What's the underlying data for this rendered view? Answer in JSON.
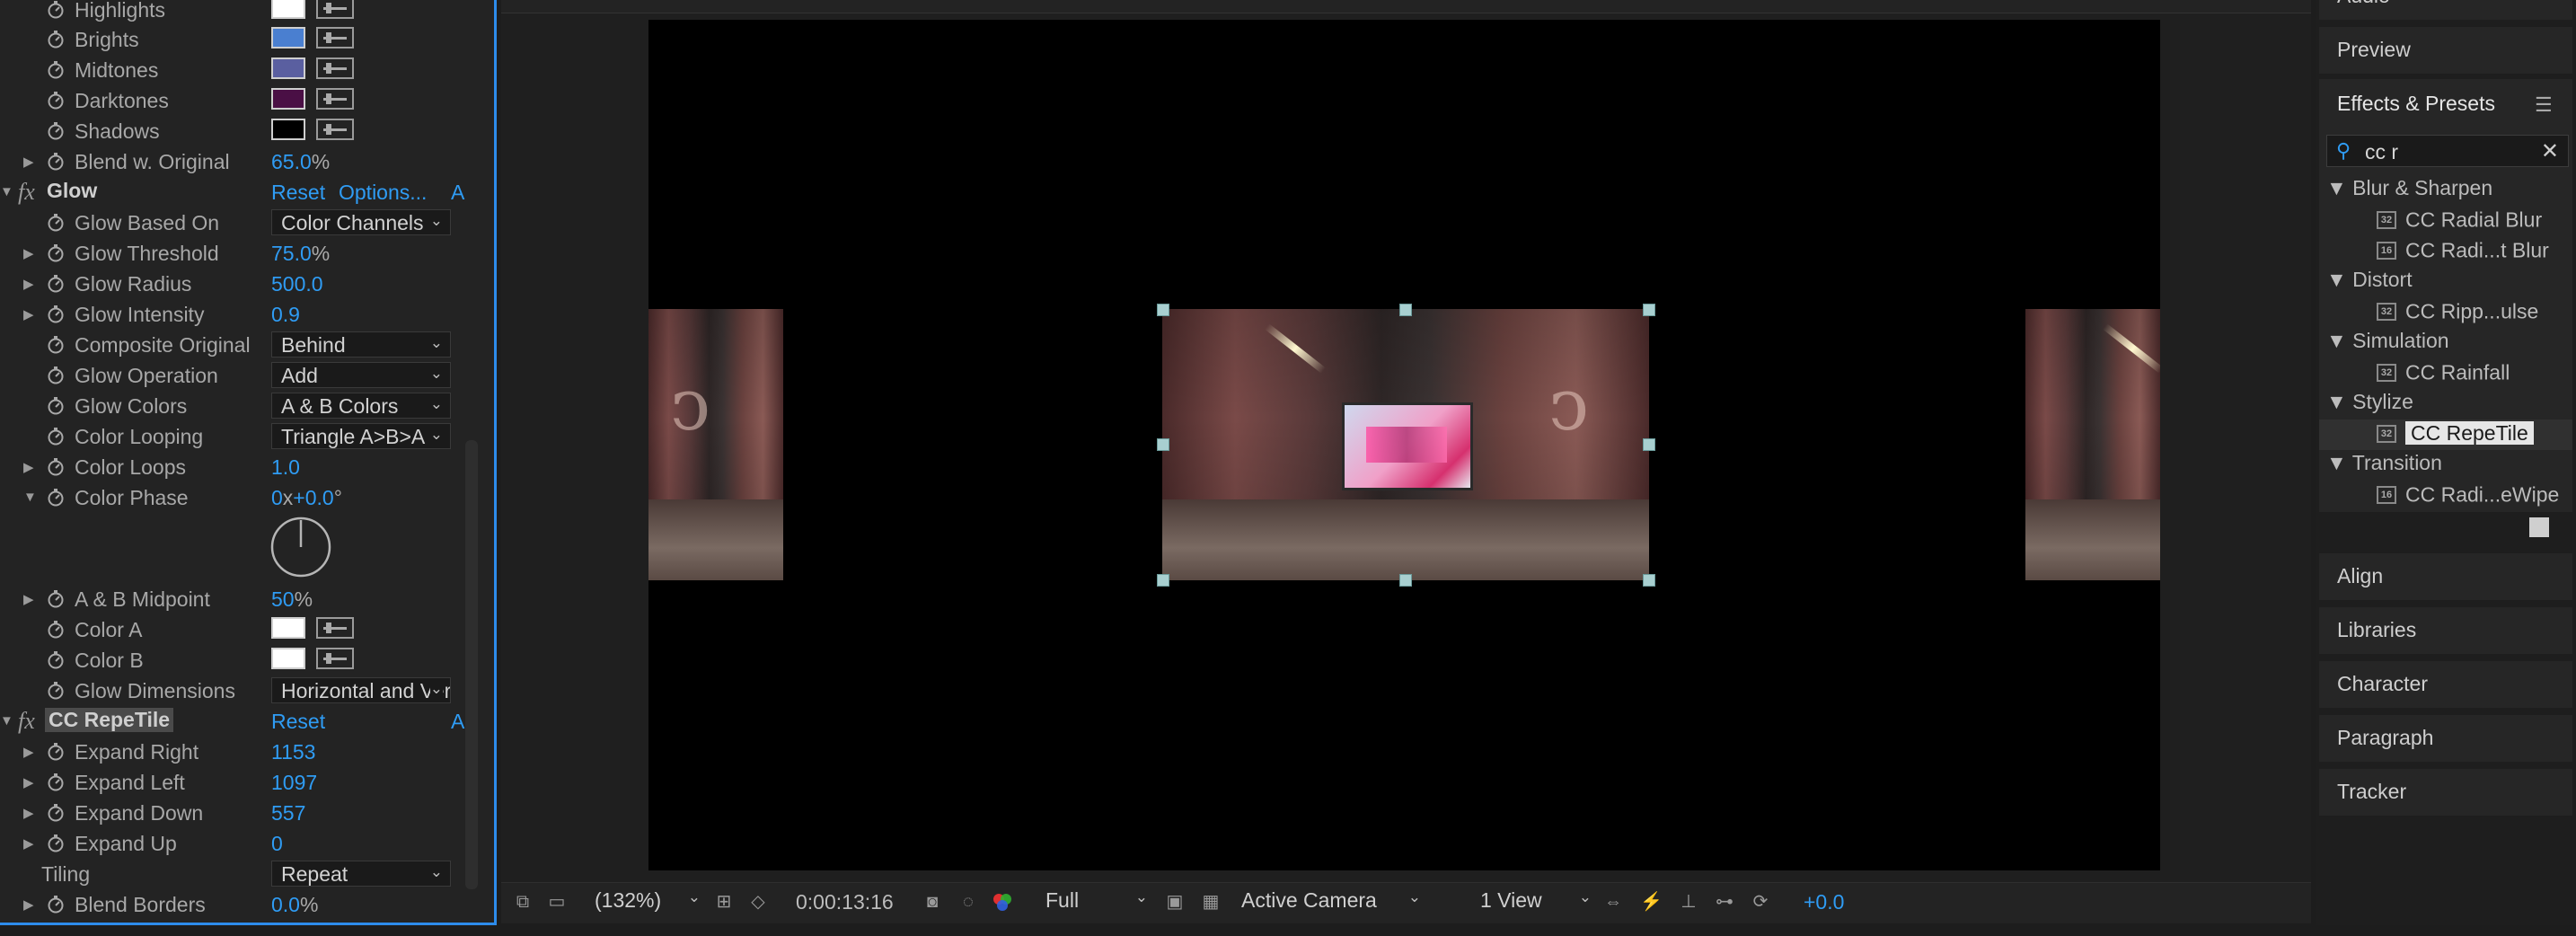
{
  "effect_controls": {
    "rows": [
      {
        "label": "Highlights",
        "type": "color",
        "color": "#ffffff"
      },
      {
        "label": "Brights",
        "type": "color",
        "color": "#4a7fd0"
      },
      {
        "label": "Midtones",
        "type": "color",
        "color": "#5a5fa0"
      },
      {
        "label": "Darktones",
        "type": "color",
        "color": "#4a0f45"
      },
      {
        "label": "Shadows",
        "type": "color",
        "color": "#000000"
      },
      {
        "label": "Blend w. Original",
        "value": "65.0",
        "unit": "%"
      }
    ],
    "glow": {
      "title": "Glow",
      "fx": "fx",
      "reset": "Reset",
      "options": "Options...",
      "about": "A",
      "glow_based_on": {
        "label": "Glow Based On",
        "value": "Color Channels"
      },
      "glow_threshold": {
        "label": "Glow Threshold",
        "value": "75.0",
        "unit": "%"
      },
      "glow_radius": {
        "label": "Glow Radius",
        "value": "500.0"
      },
      "glow_intensity": {
        "label": "Glow Intensity",
        "value": "0.9"
      },
      "composite_original": {
        "label": "Composite Original",
        "value": "Behind"
      },
      "glow_operation": {
        "label": "Glow Operation",
        "value": "Add"
      },
      "glow_colors": {
        "label": "Glow Colors",
        "value": "A & B Colors"
      },
      "color_looping": {
        "label": "Color Looping",
        "value": "Triangle A>B>A"
      },
      "color_loops": {
        "label": "Color Loops",
        "value": "1.0"
      },
      "color_phase": {
        "label": "Color Phase",
        "rev": "0",
        "x": "x",
        "deg": "+0.0",
        "deg_unit": "°"
      },
      "ab_midpoint": {
        "label": "A & B Midpoint",
        "value": "50",
        "unit": "%"
      },
      "color_a": {
        "label": "Color A",
        "color": "#ffffff"
      },
      "color_b": {
        "label": "Color B",
        "color": "#ffffff"
      },
      "glow_dimensions": {
        "label": "Glow Dimensions",
        "value": "Horizontal and Vertical"
      }
    },
    "repetile": {
      "title": "CC RepeTile",
      "fx": "fx",
      "reset": "Reset",
      "about": "A",
      "expand_right": {
        "label": "Expand Right",
        "value": "1153"
      },
      "expand_left": {
        "label": "Expand Left",
        "value": "1097"
      },
      "expand_down": {
        "label": "Expand Down",
        "value": "557"
      },
      "expand_up": {
        "label": "Expand Up",
        "value": "0"
      },
      "tiling": {
        "label": "Tiling",
        "value": "Repeat"
      },
      "blend_borders": {
        "label": "Blend Borders",
        "value": "0.0",
        "unit": "%"
      }
    }
  },
  "viewer_bar": {
    "zoom": "(132%)",
    "timecode": "0:00:13:16",
    "resolution": "Full",
    "camera": "Active Camera",
    "views": "1 View",
    "exposure": "+0.0"
  },
  "right_panels": {
    "audio": "Audio",
    "preview": "Preview",
    "effects_presets": {
      "title": "Effects & Presets",
      "search_value": "cc r",
      "categories": [
        {
          "name": "Blur & Sharpen",
          "items": [
            {
              "name": "CC Radial Blur",
              "icon": "32"
            },
            {
              "name": "CC Radi...t Blur",
              "icon": "16"
            }
          ]
        },
        {
          "name": "Distort",
          "items": [
            {
              "name": "CC Ripp...ulse",
              "icon": "32"
            }
          ]
        },
        {
          "name": "Simulation",
          "items": [
            {
              "name": "CC Rainfall",
              "icon": "32"
            }
          ]
        },
        {
          "name": "Stylize",
          "items": [
            {
              "name": "CC RepeTile",
              "icon": "32",
              "selected": true
            }
          ]
        },
        {
          "name": "Transition",
          "items": [
            {
              "name": "CC Radi...eWipe",
              "icon": "16"
            }
          ]
        }
      ]
    },
    "align": "Align",
    "libraries": "Libraries",
    "character": "Character",
    "paragraph": "Paragraph",
    "tracker": "Tracker"
  }
}
